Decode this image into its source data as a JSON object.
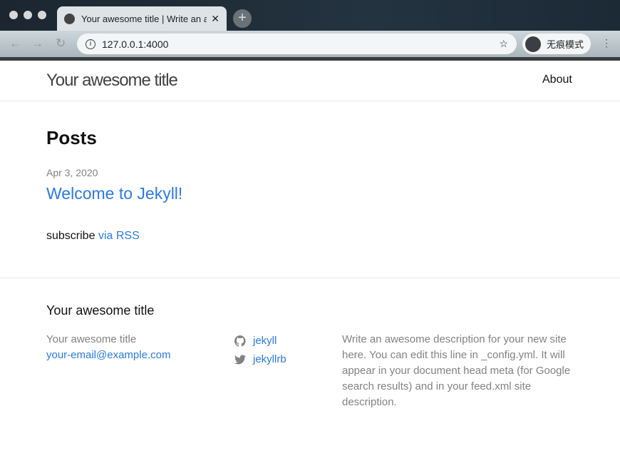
{
  "browser": {
    "tab_title": "Your awesome title | Write an awesome description",
    "url": "127.0.0.1:4000",
    "incognito_label": "无痕模式"
  },
  "header": {
    "site_title": "Your awesome title",
    "nav": [
      {
        "label": "About"
      }
    ]
  },
  "main": {
    "heading": "Posts",
    "posts": [
      {
        "date": "Apr 3, 2020",
        "title": "Welcome to Jekyll!"
      }
    ],
    "subscribe_text": "subscribe",
    "subscribe_link": "via RSS"
  },
  "footer": {
    "heading": "Your awesome title",
    "name": "Your awesome title",
    "email": "your-email@example.com",
    "social": [
      {
        "icon": "github-icon",
        "label": "jekyll"
      },
      {
        "icon": "twitter-icon",
        "label": "jekyllrb"
      }
    ],
    "description": "Write an awesome description for your new site here. You can edit this line in _config.yml. It will appear in your document head meta (for Google search results) and in your feed.xml site description."
  }
}
